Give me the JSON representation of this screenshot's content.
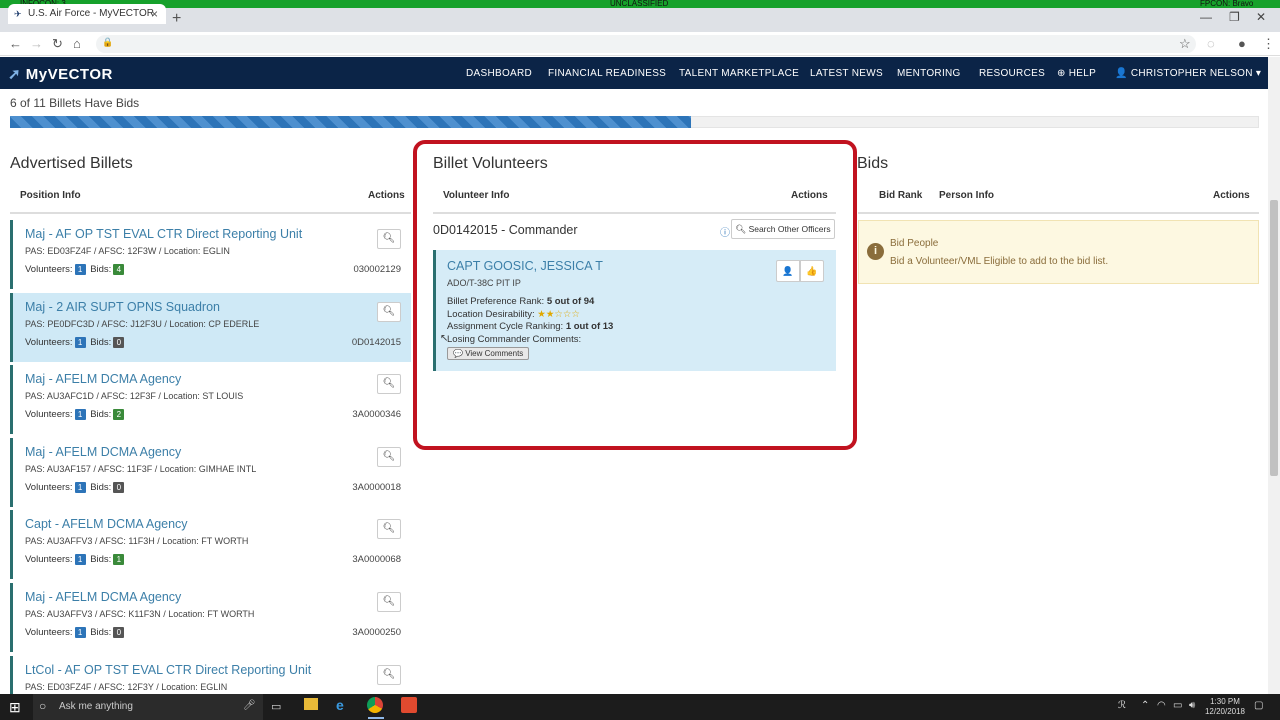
{
  "banner": {
    "left": "INFOCON: 3",
    "center": "UNCLASSIFIED",
    "right": "FPCON: Bravo"
  },
  "browser": {
    "tab_title": "U.S. Air Force - MyVECTOR",
    "url": ""
  },
  "nav": {
    "logo": "MyVECTOR",
    "items": [
      "DASHBOARD",
      "FINANCIAL READINESS",
      "TALENT MARKETPLACE",
      "LATEST NEWS",
      "MENTORING",
      "RESOURCES"
    ],
    "help": "HELP",
    "user": "CHRISTOPHER NELSON"
  },
  "progress": {
    "text": "6 of 11 Billets Have Bids",
    "fraction": 0.5455
  },
  "advertised": {
    "title": "Advertised Billets",
    "col_position": "Position Info",
    "col_actions": "Actions",
    "volunteers_label": "Volunteers:",
    "bids_label": "Bids:",
    "billets": [
      {
        "title": "Maj - AF OP TST EVAL CTR Direct Reporting Unit",
        "pas": "PAS: ED03FZ4F / AFSC: 12F3W / Location: EGLIN",
        "volunteers": "1",
        "bids": "4",
        "id": "030002129",
        "selected": false
      },
      {
        "title": "Maj - 2 AIR SUPT OPNS Squadron",
        "pas": "PAS: PE0DFC3D / AFSC: J12F3U / Location: CP EDERLE",
        "volunteers": "1",
        "bids": "0",
        "id": "0D0142015",
        "selected": true
      },
      {
        "title": "Maj - AFELM DCMA Agency",
        "pas": "PAS: AU3AFC1D / AFSC: 12F3F / Location: ST LOUIS",
        "volunteers": "1",
        "bids": "2",
        "id": "3A0000346",
        "selected": false
      },
      {
        "title": "Maj - AFELM DCMA Agency",
        "pas": "PAS: AU3AF157 / AFSC: 11F3F / Location: GIMHAE INTL",
        "volunteers": "1",
        "bids": "0",
        "id": "3A0000018",
        "selected": false
      },
      {
        "title": "Capt - AFELM DCMA Agency",
        "pas": "PAS: AU3AFFV3 / AFSC: 11F3H / Location: FT WORTH",
        "volunteers": "1",
        "bids": "1",
        "id": "3A0000068",
        "selected": false
      },
      {
        "title": "Maj - AFELM DCMA Agency",
        "pas": "PAS: AU3AFFV3 / AFSC: K11F3N / Location: FT WORTH",
        "volunteers": "1",
        "bids": "0",
        "id": "3A0000250",
        "selected": false
      },
      {
        "title": "LtCol - AF OP TST EVAL CTR Direct Reporting Unit",
        "pas": "PAS: ED03FZ4F / AFSC: 12F3Y / Location: EGLIN",
        "volunteers": "",
        "bids": "",
        "id": "",
        "selected": false
      }
    ]
  },
  "volunteers": {
    "title": "Billet Volunteers",
    "col_info": "Volunteer Info",
    "col_actions": "Actions",
    "billet_heading": "0D0142015 - Commander",
    "search_other": "Search Other Officers",
    "person": {
      "name": "CAPT GOOSIC, JESSICA T",
      "role": "ADO/T-38C PIT IP",
      "pref_label": "Billet Preference Rank:",
      "pref_value": "5 out of 94",
      "desir_label": "Location Desirability:",
      "desir_stars": 2,
      "desir_max": 5,
      "cycle_label": "Assignment Cycle Ranking:",
      "cycle_value": "1 out of 13",
      "comments_label": "Losing Commander Comments:",
      "view_comments": "View Comments"
    }
  },
  "bids": {
    "title": "Bids",
    "col_rank": "Bid Rank",
    "col_person": "Person Info",
    "col_actions": "Actions",
    "empty_title": "Bid People",
    "empty_text": "Bid a Volunteer/VML Eligible to add to the bid list."
  },
  "taskbar": {
    "search": "Ask me anything",
    "time": "1:30 PM",
    "date": "12/20/2018"
  }
}
